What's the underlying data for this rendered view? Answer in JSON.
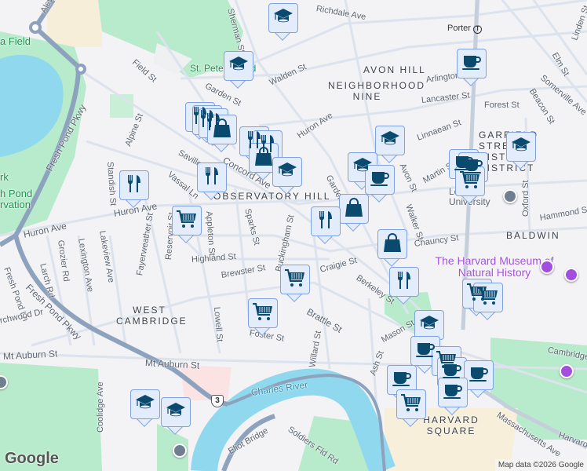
{
  "map": {
    "colors": {
      "background": "#f3f2f5",
      "park": "#b7ebcb",
      "water": "#8fd8ee",
      "parkway": "#8da2bd",
      "road": "#dde3ec",
      "marker_fill": "#e3ecfb",
      "marker_border": "#7fa2e2",
      "icon": "#0b4a6f",
      "poi_purple": "#a24fe0"
    },
    "labels": [
      "Alewife Brook Pkwy",
      "a Field",
      "St. Peter's Field",
      "Field St",
      "Garden St",
      "Sherman St",
      "Walden St",
      "Richdale Ave",
      "Porter",
      "AVON HILL",
      "NEIGHBORHOOD NINE",
      "Arlington St",
      "Lancaster St",
      "Forest St",
      "Elm St",
      "Somerville Ave",
      "Beacon St",
      "Linden St",
      "Linnaean St",
      "Huron Ave",
      "GARFIELD STREET HISTORIC DISTRICT",
      "Martin St",
      "Avon St",
      "Walker St",
      "Lesley University",
      "Oxford St",
      "Hammond St",
      "BALDWIN",
      "Chauncy St",
      "The Harvard Museum of Natural History",
      "Craigie St",
      "Berkeley St",
      "Brattle St",
      "Mason St",
      "Cambridge St",
      "Willard St",
      "Ash St",
      "HARVARD SQUARE",
      "Massachusetts Ave",
      "Harvard St",
      "Charles River",
      "Eliot Bridge",
      "Soldiers Fld Rd",
      "Mt Auburn St",
      "Mt Auburn St",
      "Coolidge Ave",
      "WEST CAMBRIDGE",
      "Lowell St",
      "Foster St",
      "Brewster St",
      "Highland St",
      "Fresh Pond Pkwy",
      "Fresh Pond Pkwy",
      "Fresh Pond Ln",
      "Larch Rd",
      "Grozier Rd",
      "Lexington Ave",
      "Lakeview Ave",
      "Fayerweather St",
      "Reservoir St",
      "Appleton St",
      "Sparks St",
      "Buckingham St",
      "Huron Ave",
      "Huron Ave",
      "Standish St",
      "Alpine St",
      "Saville St",
      "Vassal Ln",
      "Concord Ave",
      "OBSERVATORY HILL",
      "rk",
      "h Pond\nrvation",
      "Garden St",
      "rchwood Dr"
    ],
    "route_shield": "3",
    "markers": [
      "education",
      "education",
      "restaurant",
      "restaurant",
      "restaurant",
      "shopping",
      "restaurant",
      "restaurant",
      "shopping",
      "education",
      "restaurant",
      "restaurant",
      "grocery",
      "education",
      "education",
      "coffee",
      "shopping",
      "restaurant",
      "shopping",
      "coffee",
      "coffee",
      "coffee",
      "grocery",
      "education",
      "grocery",
      "restaurant",
      "grocery",
      "grocery",
      "grocery",
      "education",
      "coffee",
      "grocery",
      "coffee",
      "coffee",
      "coffee",
      "coffee",
      "grocery",
      "education",
      "education"
    ],
    "logo": "Google",
    "attribution": "Map data ©2026 Google"
  }
}
